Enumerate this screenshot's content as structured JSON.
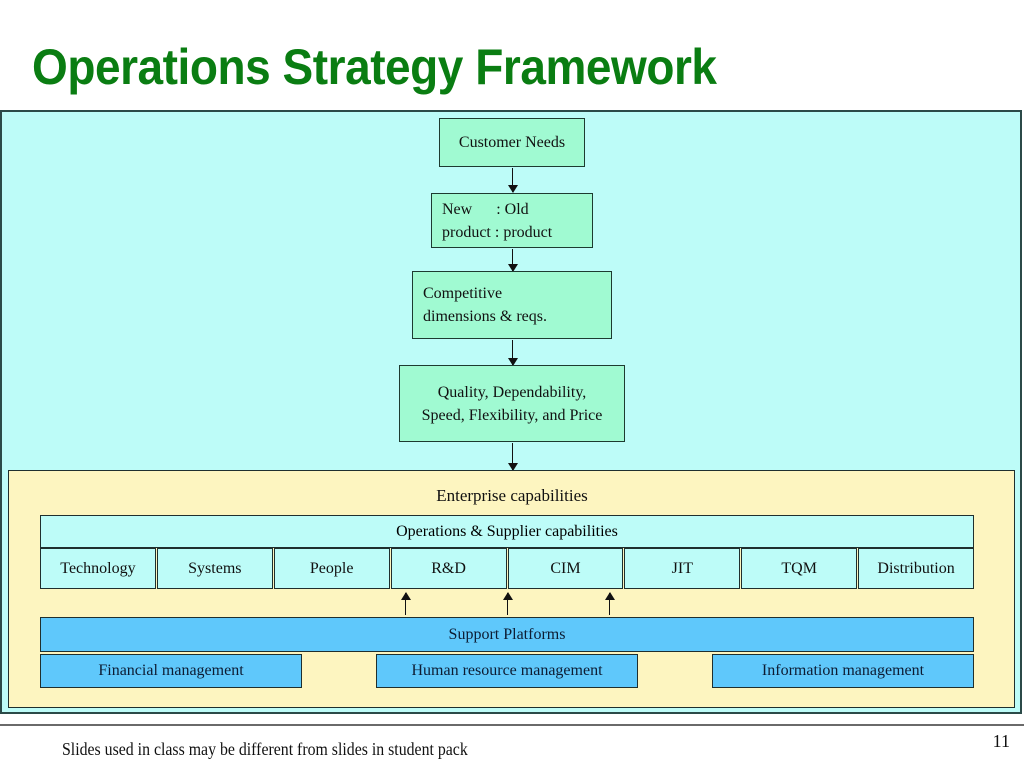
{
  "slide": {
    "title": "Operations Strategy Framework",
    "footer_note": "Slides used in class may be different from slides in student pack",
    "page_number": "11"
  },
  "colors": {
    "title": "#0a7d12",
    "outer_background": "#bdfcf8",
    "flow_box": "#a0fad2",
    "enterprise_background": "#fdf5c0",
    "capability_box": "#bdfcf8",
    "support_box": "#5fc8fb"
  },
  "flow": {
    "customer_needs": "Customer Needs",
    "product_line1": "New      : Old",
    "product_line2": "product : product",
    "competitive_line1": "Competitive",
    "competitive_line2": "dimensions & reqs.",
    "priorities_line1": "Quality, Dependability,",
    "priorities_line2": "Speed, Flexibility, and Price"
  },
  "enterprise": {
    "label": "Enterprise capabilities",
    "operations_label": "Operations & Supplier capabilities",
    "capabilities": [
      "Technology",
      "Systems",
      "People",
      "R&D",
      "CIM",
      "JIT",
      "TQM",
      "Distribution"
    ],
    "support_label": "Support Platforms",
    "platforms": [
      "Financial management",
      "Human resource management",
      "Information management"
    ]
  }
}
